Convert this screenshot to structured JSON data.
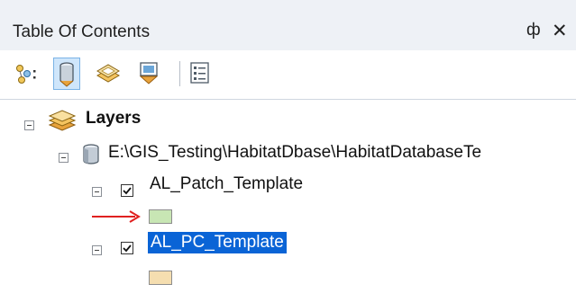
{
  "panel": {
    "title": "Table Of Contents",
    "pin_glyph": "ф",
    "close_glyph": "✕"
  },
  "toolbar": {
    "buttons": [
      {
        "icon": "list-by-drawing-order-icon"
      },
      {
        "icon": "list-by-source-icon",
        "active": true
      },
      {
        "icon": "list-by-visibility-icon"
      },
      {
        "icon": "list-by-selection-icon"
      },
      {
        "icon": "options-icon"
      }
    ]
  },
  "tree": {
    "root_label": "Layers",
    "database_label": "E:\\GIS_Testing\\HabitatDbase\\HabitatDatabaseTe",
    "layers": [
      {
        "label": "AL_Patch_Template",
        "checked": true,
        "selected": false,
        "swatch_color": "#c8e6b4"
      },
      {
        "label": "AL_PC_Template",
        "checked": true,
        "selected": true,
        "swatch_color": "#f5deb0"
      }
    ]
  },
  "colors": {
    "selection": "#0a64d6",
    "arrow": "#e0201f"
  }
}
